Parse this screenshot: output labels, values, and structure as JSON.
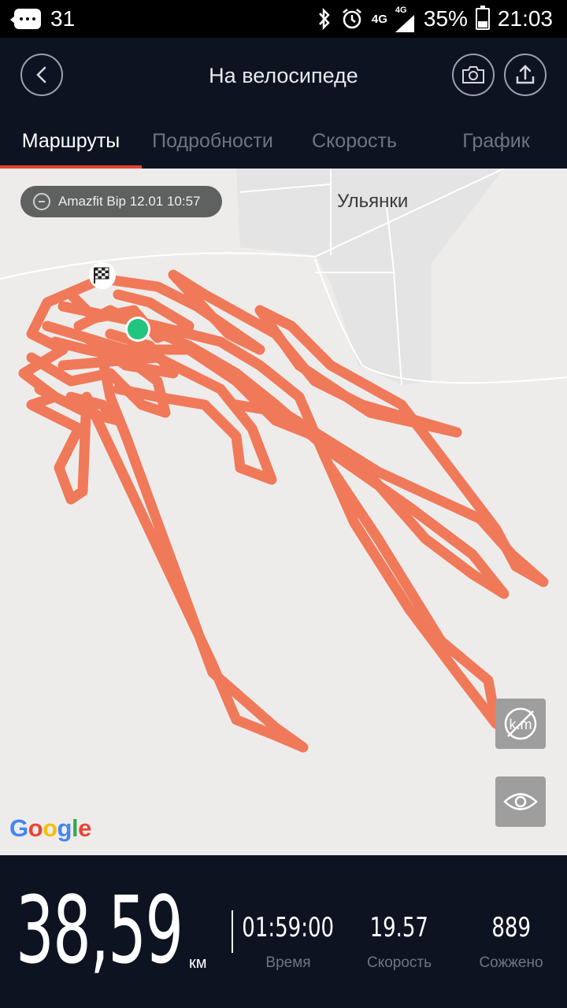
{
  "status_bar": {
    "notification_count": "31",
    "network_1": "4G",
    "network_2": "4G",
    "battery": "35%",
    "time": "21:03",
    "icons": [
      "message-icon",
      "bluetooth-icon",
      "alarm-icon",
      "signal-icon",
      "battery-icon"
    ]
  },
  "header": {
    "title": "На велосипеде",
    "back_icon": "chevron-left-icon",
    "camera_icon": "camera-icon",
    "share_icon": "upload-icon"
  },
  "tabs": [
    {
      "label": "Маршруты",
      "active": true
    },
    {
      "label": "Подробности",
      "active": false
    },
    {
      "label": "Скорость",
      "active": false
    },
    {
      "label": "График",
      "active": false
    }
  ],
  "map": {
    "device_chip": "Amazfit Bip  12.01 10:57",
    "place_label": "Ульянки",
    "route_color": "#f0795a",
    "start_color": "#22c57e",
    "provider": "Google",
    "buttons": [
      "km-markers-icon",
      "eye-icon"
    ]
  },
  "stats": {
    "distance": "38,59",
    "distance_unit": "км",
    "time_value": "01:59:00",
    "time_label": "Время",
    "speed_value": "19.57",
    "speed_label": "Скорость",
    "calories_value": "889",
    "calories_label": "Сожжено"
  },
  "colors": {
    "background": "#0e1322",
    "accent": "#e8402f",
    "tab_inactive": "#6f7483"
  }
}
